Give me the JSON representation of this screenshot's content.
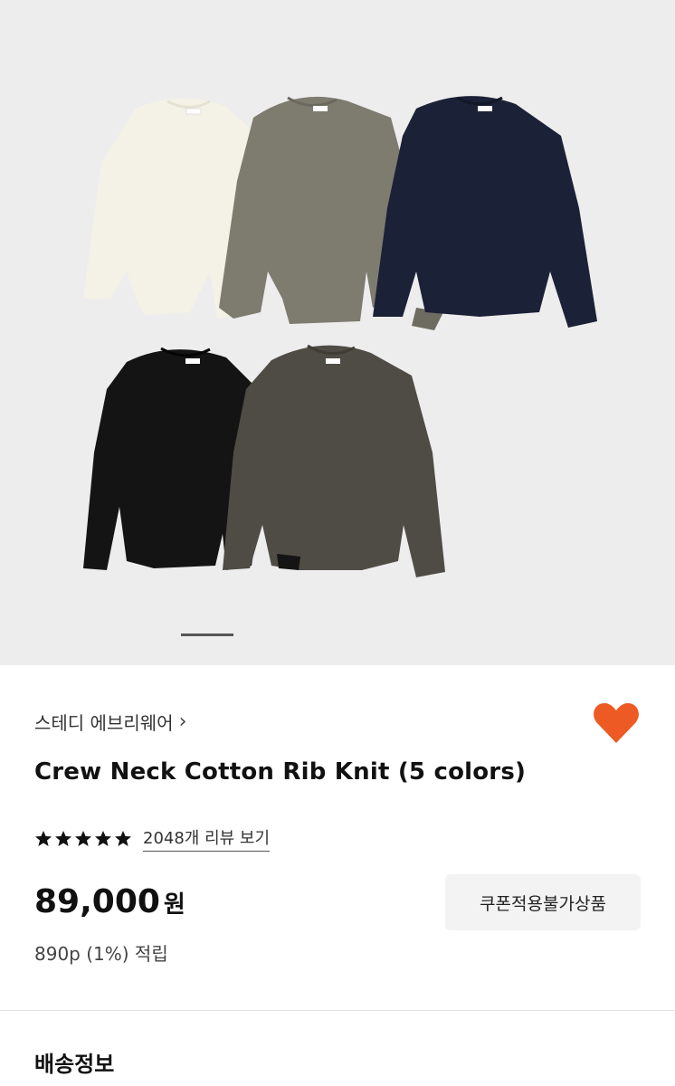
{
  "gallery": {
    "image_alt": "Crew Neck Cotton Rib Knit sweaters in five colors",
    "slide_index": 1,
    "colors": {
      "ivory": "#f3f1e7",
      "olive": "#7d7a6e",
      "navy": "#1a2035",
      "black": "#131313",
      "charcoal": "#4f4c45"
    }
  },
  "brand": {
    "name": "스테디 에브리웨어",
    "chevron": "›"
  },
  "product": {
    "title": "Crew Neck Cotton Rib Knit (5 colors)",
    "rating_stars": 5,
    "review_link": "2048개 리뷰 보기",
    "price_number": "89,000",
    "price_unit": "원",
    "coupon_badge": "쿠폰적용불가상품",
    "points": "890p (1%) 적립",
    "wishlisted": true,
    "heart_color": "#ee5a24"
  },
  "shipping": {
    "section_title": "배송정보"
  }
}
